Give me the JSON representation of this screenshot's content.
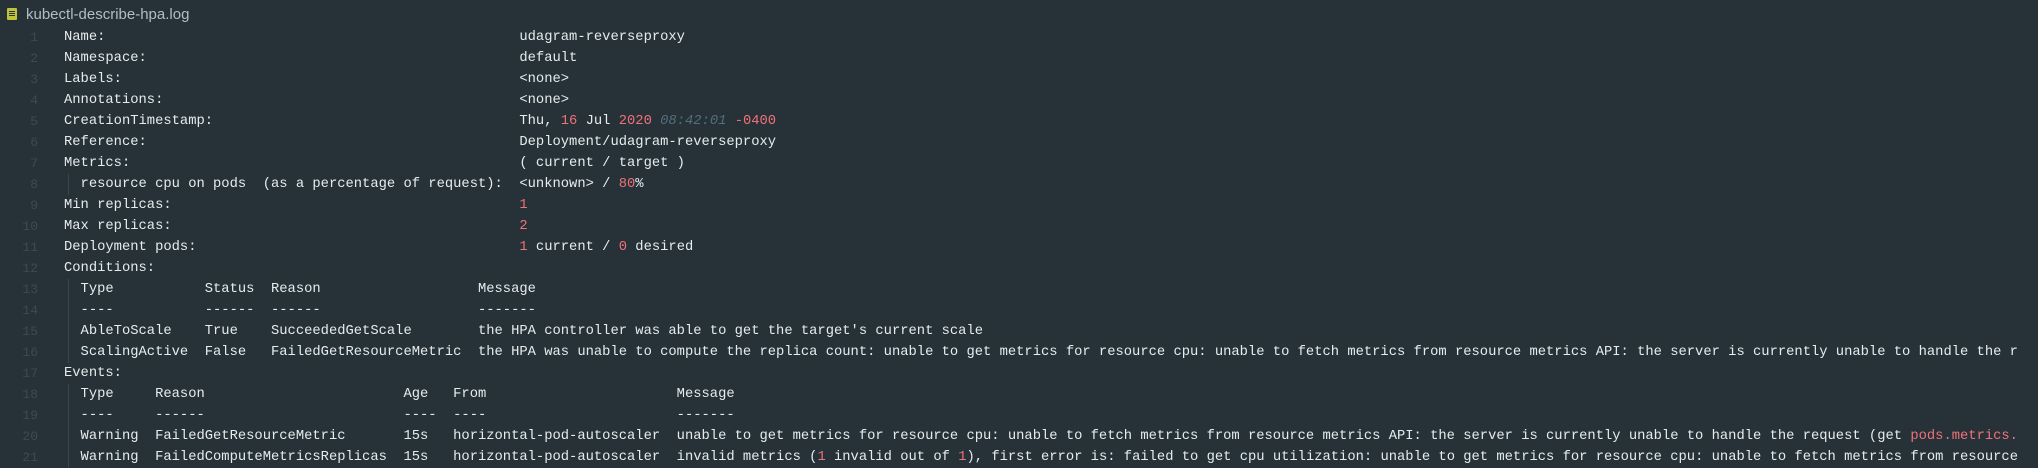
{
  "tab": {
    "title": "kubectl-describe-hpa.log",
    "icon": "log-file-icon"
  },
  "colors": {
    "background": "#263238",
    "text": "#e6ecee",
    "number": "#f07178",
    "time": "#546e7a"
  },
  "lines": [
    {
      "n": "1",
      "segments": [
        {
          "t": "Name:                                                  udagram-reverseproxy"
        }
      ]
    },
    {
      "n": "2",
      "segments": [
        {
          "t": "Namespace:                                             default"
        }
      ]
    },
    {
      "n": "3",
      "segments": [
        {
          "t": "Labels:                                                <none>"
        }
      ]
    },
    {
      "n": "4",
      "segments": [
        {
          "t": "Annotations:                                           <none>"
        }
      ]
    },
    {
      "n": "5",
      "segments": [
        {
          "t": "CreationTimestamp:                                     Thu, "
        },
        {
          "t": "16",
          "c": "num"
        },
        {
          "t": " Jul "
        },
        {
          "t": "2020",
          "c": "num"
        },
        {
          "t": " "
        },
        {
          "t": "08:42:01",
          "c": "time"
        },
        {
          "t": " "
        },
        {
          "t": "-0400",
          "c": "num"
        }
      ]
    },
    {
      "n": "6",
      "segments": [
        {
          "t": "Reference:                                             Deployment/udagram-reverseproxy"
        }
      ]
    },
    {
      "n": "7",
      "segments": [
        {
          "t": "Metrics:                                               ( current / target )"
        }
      ]
    },
    {
      "n": "8",
      "guide": true,
      "segments": [
        {
          "t": "  resource cpu on pods  (as a percentage of request):  <unknown> / "
        },
        {
          "t": "80",
          "c": "num"
        },
        {
          "t": "%"
        }
      ]
    },
    {
      "n": "9",
      "segments": [
        {
          "t": "Min replicas:                                          "
        },
        {
          "t": "1",
          "c": "num"
        }
      ]
    },
    {
      "n": "10",
      "segments": [
        {
          "t": "Max replicas:                                          "
        },
        {
          "t": "2",
          "c": "num"
        }
      ]
    },
    {
      "n": "11",
      "segments": [
        {
          "t": "Deployment pods:                                       "
        },
        {
          "t": "1",
          "c": "num"
        },
        {
          "t": " current / "
        },
        {
          "t": "0",
          "c": "num"
        },
        {
          "t": " desired"
        }
      ]
    },
    {
      "n": "12",
      "segments": [
        {
          "t": "Conditions:"
        }
      ]
    },
    {
      "n": "13",
      "guide": true,
      "segments": [
        {
          "t": "  Type           Status  Reason                   Message"
        }
      ]
    },
    {
      "n": "14",
      "guide": true,
      "segments": [
        {
          "t": "  ----           ------  ------                   -------"
        }
      ]
    },
    {
      "n": "15",
      "guide": true,
      "segments": [
        {
          "t": "  AbleToScale    True    SucceededGetScale        the HPA controller was able to get the target's current scale"
        }
      ]
    },
    {
      "n": "16",
      "guide": true,
      "segments": [
        {
          "t": "  ScalingActive  False   FailedGetResourceMetric  the HPA was unable to compute the replica count: unable to get metrics for resource cpu: unable to fetch metrics from resource metrics API: the server is currently unable to handle the r"
        }
      ]
    },
    {
      "n": "17",
      "segments": [
        {
          "t": "Events:"
        }
      ]
    },
    {
      "n": "18",
      "guide": true,
      "segments": [
        {
          "t": "  Type     Reason                        Age   From                       Message"
        }
      ]
    },
    {
      "n": "19",
      "guide": true,
      "segments": [
        {
          "t": "  ----     ------                        ----  ----                       -------"
        }
      ]
    },
    {
      "n": "20",
      "guide": true,
      "segments": [
        {
          "t": "  Warning  FailedGetResourceMetric       15s   horizontal-pod-autoscaler  unable to get metrics for resource cpu: unable to fetch metrics from resource metrics API: the server is currently unable to handle the request (get "
        },
        {
          "t": "pods.metrics.",
          "c": "ref"
        }
      ]
    },
    {
      "n": "21",
      "guide": true,
      "segments": [
        {
          "t": "  Warning  FailedComputeMetricsReplicas  15s   horizontal-pod-autoscaler  invalid metrics ("
        },
        {
          "t": "1",
          "c": "num"
        },
        {
          "t": " invalid out of "
        },
        {
          "t": "1",
          "c": "num"
        },
        {
          "t": "), first error is: failed to get cpu utilization: unable to get metrics for resource cpu: unable to fetch metrics from resource"
        }
      ]
    }
  ]
}
